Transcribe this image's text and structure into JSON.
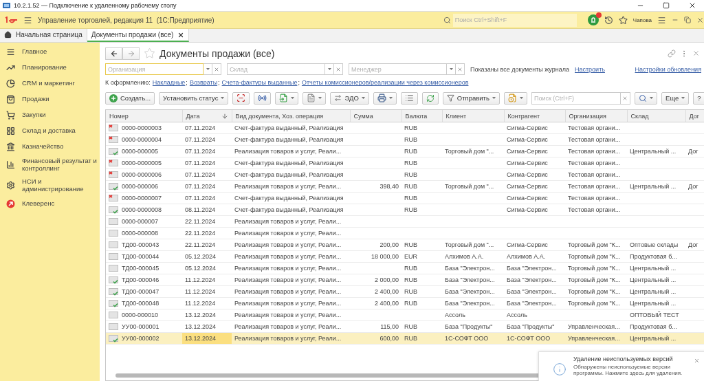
{
  "rdp_window": {
    "title": "10.2.1.52 — Подключение к удаленному рабочему столу"
  },
  "app_header": {
    "title": "Управление торговлей, редакция 11  (1С:Предприятие)",
    "search": {
      "placeholder": "Поиск Ctrl+Shift+F"
    },
    "user": "Чапова"
  },
  "tabs": [
    {
      "label": "Начальная страница",
      "kind": "home",
      "selected": false
    },
    {
      "label": "Документы продажи (все)",
      "kind": "document",
      "selected": true
    }
  ],
  "sidebar": {
    "items": [
      {
        "label": "Главное",
        "kind": "main"
      },
      {
        "label": "Планирование",
        "kind": "planning"
      },
      {
        "label": "CRM и маркетинг",
        "kind": "crm"
      },
      {
        "label": "Продажи",
        "kind": "sales"
      },
      {
        "label": "Закупки",
        "kind": "purchases"
      },
      {
        "label": "Склад и доставка",
        "kind": "warehouse"
      },
      {
        "label": "Казначейство",
        "kind": "treasury"
      },
      {
        "label": "Финансовый результат и контроллинг",
        "kind": "finance"
      },
      {
        "label": "НСИ и администрирование",
        "kind": "admin"
      },
      {
        "label": "Клеверенс",
        "kind": "cleverence"
      }
    ]
  },
  "form": {
    "title": "Документы продажи (все)",
    "filters": [
      {
        "placeholder": "Организация",
        "focused": true
      },
      {
        "placeholder": "Склад",
        "focused": false
      },
      {
        "placeholder": "Менеджер",
        "focused": false
      }
    ],
    "info": "Показаны все документы журнала",
    "configure_link": "Настроить",
    "update_settings_link": "Настройки обновления",
    "to_process": {
      "label": "К оформлению:",
      "links": [
        {
          "label": "Накладные",
          "suffix": ";"
        },
        {
          "label": "Возвраты",
          "suffix": ";"
        },
        {
          "label": "Счета-фактуры выданные",
          "suffix": ";"
        },
        {
          "label": "Отчеты комиссионеров/реализации через комиссионеров"
        }
      ]
    },
    "toolbar": [
      {
        "kind": "create",
        "label": "Создать..."
      },
      {
        "kind": "menu",
        "label": "Установить статус",
        "dropdown": true
      },
      {
        "kind": "scan"
      },
      {
        "kind": "equipment"
      },
      {
        "kind": "generate",
        "dropdown": true
      },
      {
        "kind": "report",
        "dropdown": true
      },
      {
        "kind": "edo",
        "label": "ЭДО",
        "dropdown": true
      },
      {
        "kind": "print",
        "dropdown": true
      },
      {
        "kind": "list"
      },
      {
        "kind": "refresh"
      },
      {
        "kind": "send",
        "label": "Отправить",
        "dropdown": true
      },
      {
        "kind": "attach",
        "dropdown": true
      },
      {
        "kind": "search",
        "placeholder": "Поиск (Ctrl+F)"
      },
      {
        "kind": "find",
        "dropdown": true
      },
      {
        "kind": "menu",
        "label": "Еще",
        "dropdown": true
      },
      {
        "kind": "help",
        "label": "?"
      }
    ],
    "table": {
      "columns": [
        {
          "label": "Номер",
          "sorted": false
        },
        {
          "label": "Дата",
          "sorted": true
        },
        {
          "label": "Вид документа, Хоз. операция",
          "sorted": false
        },
        {
          "label": "Сумма",
          "sorted": false
        },
        {
          "label": "Валюта",
          "sorted": false
        },
        {
          "label": "Клиент",
          "sorted": false
        },
        {
          "label": "Контрагент",
          "sorted": false
        },
        {
          "label": "Организация",
          "sorted": false
        },
        {
          "label": "Склад",
          "sorted": false
        },
        {
          "label": "Дог"
        }
      ],
      "rows": [
        {
          "kind": "cancelled",
          "selected": false,
          "number": "0000-0000003",
          "date": "07.11.2024",
          "doc_type": "Счет-фактура выданный, Реализация",
          "currency": "RUB",
          "counterparty": "Сигма-Сервис",
          "organization": "Тестовая органи..."
        },
        {
          "kind": "cancelled",
          "selected": false,
          "number": "0000-0000004",
          "date": "07.11.2024",
          "doc_type": "Счет-фактура выданный, Реализация",
          "currency": "RUB",
          "counterparty": "Сигма-Сервис",
          "organization": "Тестовая органи..."
        },
        {
          "kind": "posted",
          "selected": false,
          "number": "0000-000005",
          "date": "07.11.2024",
          "doc_type": "Реализация товаров и услуг, Реали...",
          "currency": "RUB",
          "client": "Торговый дом \"...",
          "counterparty": "Сигма-Сервис",
          "organization": "Тестовая органи...",
          "warehouse": "Центральный ...",
          "column_10": "Дог"
        },
        {
          "kind": "cancelled",
          "selected": false,
          "number": "0000-0000005",
          "date": "07.11.2024",
          "doc_type": "Счет-фактура выданный, Реализация",
          "currency": "RUB",
          "counterparty": "Сигма-Сервис",
          "organization": "Тестовая органи..."
        },
        {
          "kind": "cancelled",
          "selected": false,
          "number": "0000-0000006",
          "date": "07.11.2024",
          "doc_type": "Счет-фактура выданный, Реализация",
          "currency": "RUB",
          "counterparty": "Сигма-Сервис",
          "organization": "Тестовая органи..."
        },
        {
          "kind": "posted",
          "selected": false,
          "number": "0000-000006",
          "date": "07.11.2024",
          "doc_type": "Реализация товаров и услуг, Реали...",
          "sum": "398,40",
          "currency": "RUB",
          "client": "Торговый дом \"...",
          "counterparty": "Сигма-Сервис",
          "organization": "Тестовая органи...",
          "warehouse": "Центральный ...",
          "column_10": "Дог"
        },
        {
          "kind": "cancelled",
          "selected": false,
          "number": "0000-0000007",
          "date": "07.11.2024",
          "doc_type": "Счет-фактура выданный, Реализация",
          "currency": "RUB",
          "counterparty": "Сигма-Сервис",
          "organization": "Тестовая органи..."
        },
        {
          "kind": "posted",
          "selected": false,
          "number": "0000-0000008",
          "date": "08.11.2024",
          "doc_type": "Счет-фактура выданный, Реализация",
          "currency": "RUB",
          "counterparty": "Сигма-Сервис",
          "organization": "Тестовая органи..."
        },
        {
          "kind": "draft",
          "selected": false,
          "number": "0000-000007",
          "date": "22.11.2024",
          "doc_type": "Реализация товаров и услуг, Реали..."
        },
        {
          "kind": "draft",
          "selected": false,
          "number": "0000-000008",
          "date": "22.11.2024",
          "doc_type": "Реализация товаров и услуг, Реали..."
        },
        {
          "kind": "draft",
          "selected": false,
          "number": "ТД00-000043",
          "date": "22.11.2024",
          "doc_type": "Реализация товаров и услуг, Реали...",
          "sum": "200,00",
          "currency": "RUB",
          "client": "Торговый дом \"...",
          "counterparty": "Сигма-Сервис",
          "organization": "Торговый дом \"К...",
          "warehouse": "Оптовые склады",
          "column_10": "Дог"
        },
        {
          "kind": "draft",
          "selected": false,
          "number": "ТД00-000044",
          "date": "05.12.2024",
          "doc_type": "Реализация товаров и услуг, Реали...",
          "sum": "18 000,00",
          "currency": "EUR",
          "client": "Алхимов А.А.",
          "counterparty": "Алхимов А.А.",
          "organization": "Торговый дом \"К...",
          "warehouse": "Продуктовая б..."
        },
        {
          "kind": "draft",
          "selected": false,
          "number": "ТД00-000045",
          "date": "05.12.2024",
          "doc_type": "Реализация товаров и услуг, Реали...",
          "currency": "RUB",
          "client": "База \"Электрон...",
          "counterparty": "База \"Электрон...",
          "organization": "Торговый дом \"К...",
          "warehouse": "Центральный ..."
        },
        {
          "kind": "posted",
          "selected": false,
          "number": "ТД00-000046",
          "date": "11.12.2024",
          "doc_type": "Реализация товаров и услуг, Реали...",
          "sum": "2 000,00",
          "currency": "RUB",
          "client": "База \"Электрон...",
          "counterparty": "База \"Электрон...",
          "organization": "Торговый дом \"К...",
          "warehouse": "Центральный ..."
        },
        {
          "kind": "posted",
          "selected": false,
          "number": "ТД00-000047",
          "date": "11.12.2024",
          "doc_type": "Реализация товаров и услуг, Реали...",
          "sum": "2 400,00",
          "currency": "RUB",
          "client": "База \"Электрон...",
          "counterparty": "База \"Электрон...",
          "organization": "Торговый дом \"К...",
          "warehouse": "Центральный ..."
        },
        {
          "kind": "posted",
          "selected": false,
          "number": "ТД00-000048",
          "date": "11.12.2024",
          "doc_type": "Реализация товаров и услуг, Реали...",
          "sum": "2 400,00",
          "currency": "RUB",
          "client": "База \"Электрон...",
          "counterparty": "База \"Электрон...",
          "organization": "Торговый дом \"К...",
          "warehouse": "Центральный ..."
        },
        {
          "kind": "draft",
          "selected": false,
          "number": "0000-000010",
          "date": "13.12.2024",
          "doc_type": "Реализация товаров и услуг, Реали...",
          "client": "Ассоль",
          "counterparty": "Ассоль",
          "warehouse": "ОПТОВЫЙ ТЕСТ"
        },
        {
          "kind": "draft",
          "selected": false,
          "number": "УУ00-000001",
          "date": "13.12.2024",
          "doc_type": "Реализация товаров и услуг, Реали...",
          "sum": "115,00",
          "currency": "RUB",
          "client": "База \"Продукты\"",
          "counterparty": "База \"Продукты\"",
          "organization": "Управленческая...",
          "warehouse": "Продуктовая б..."
        },
        {
          "kind": "posted",
          "selected": true,
          "number": "УУ00-000002",
          "date": "13.12.2024",
          "doc_type": "Реализация товаров и услуг, Реали...",
          "sum": "600,00",
          "currency": "RUB",
          "client": "1С-СОФТ ООО",
          "counterparty": "1С-СОФТ ООО",
          "organization": "Управленческая...",
          "warehouse": "Центральный ..."
        }
      ]
    }
  },
  "notification": {
    "title": "Удаление неиспользуемых версий",
    "text": "Обнаружены неиспользуемые версии программы. Нажмите здесь для удаления."
  }
}
